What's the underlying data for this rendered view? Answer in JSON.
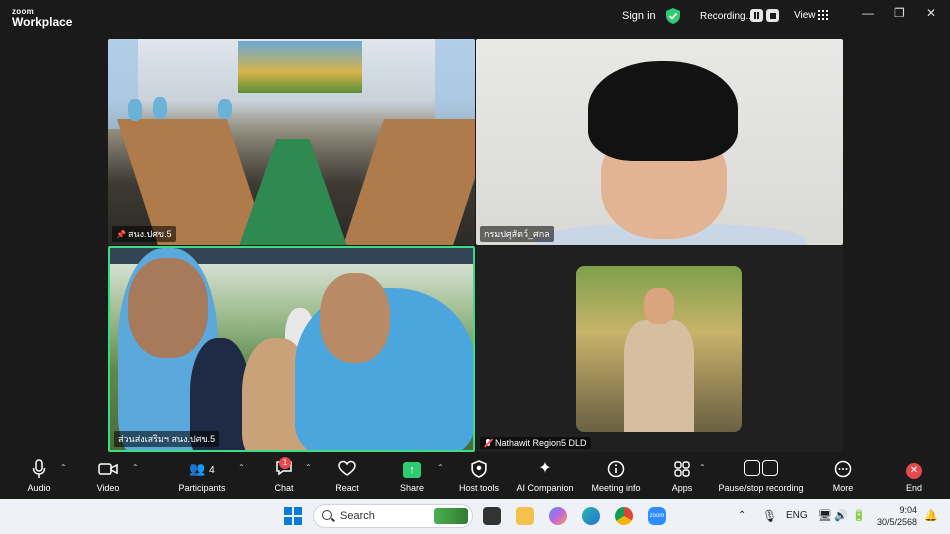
{
  "app": {
    "brand_top": "zoom",
    "brand_bottom": "Workplace"
  },
  "titlebar": {
    "sign_in": "Sign in",
    "recording_label": "Recording...",
    "view_label": "View",
    "minimize": "—",
    "restore": "❐",
    "close": "✕"
  },
  "participants": [
    {
      "name": "สนง.ปศข.5",
      "pinned": true
    },
    {
      "name": "กรมปศุสัตว์_ศกล"
    },
    {
      "name": "ส่วนส่งเสริมฯ สนง.ปศข.5",
      "active_speaker": true
    },
    {
      "name": "Nathawit Region5 DLD",
      "muted": true
    }
  ],
  "toolbar": {
    "audio": "Audio",
    "video": "Video",
    "participants": "Participants",
    "participants_count": "4",
    "chat": "Chat",
    "chat_badge": "1",
    "react": "React",
    "share": "Share",
    "host_tools": "Host tools",
    "ai_companion": "AI Companion",
    "meeting_info": "Meeting info",
    "apps": "Apps",
    "pause_stop_recording": "Pause/stop recording",
    "more": "More",
    "end": "End"
  },
  "taskbar": {
    "search_placeholder": "Search",
    "language": "ENG",
    "time": "9:04",
    "date": "30/5/2568"
  },
  "colors": {
    "active_speaker_border": "#3ddc84",
    "share_green": "#2ecc71",
    "end_red": "#e5484d",
    "shield_green": "#2ecc71"
  }
}
